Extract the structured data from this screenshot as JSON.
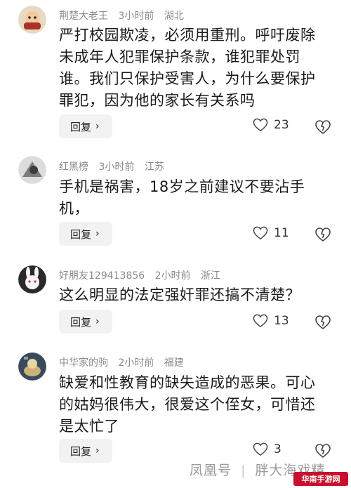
{
  "comments": [
    {
      "username": "荆楚大老王",
      "time": "3小时前",
      "location": "湖北",
      "lines": [
        "严打校园欺凌，必须用重刑。呼吁废除",
        "未成年人犯罪保护条款，谁犯罪处罚",
        "谁。我们只保护受害人，为什么要保护",
        "罪犯，因为他的家长有关系吗"
      ],
      "reply_label": "回复",
      "likes": "23"
    },
    {
      "username": "红黑榜",
      "time": "3小时前",
      "location": "江苏",
      "lines": [
        "手机是祸害，18岁之前建议不要沾手",
        "机，"
      ],
      "reply_label": "回复",
      "likes": "11"
    },
    {
      "username": "好朋友129413856",
      "time": "2小时前",
      "location": "浙江",
      "lines": [
        "这么明显的法定强奸罪还搞不清楚？"
      ],
      "reply_label": "回复",
      "likes": "13"
    },
    {
      "username": "中华家的驹",
      "time": "2小时前",
      "location": "福建",
      "lines": [
        "缺爱和性教育的缺失造成的恶果。可心",
        "的姑妈很伟大，很爱这个侄女，可惜还",
        "是太忙了"
      ],
      "reply_label": "回复",
      "likes": "3"
    }
  ],
  "watermark": {
    "source": "凤凰号",
    "separator": "|",
    "author": "胖大海戏精"
  },
  "site_badge": "华南手游网",
  "colors": {
    "meta_gray": "#8a8a8a",
    "reply_bg": "#f2f2f2",
    "badge_red": "#c8102e"
  }
}
